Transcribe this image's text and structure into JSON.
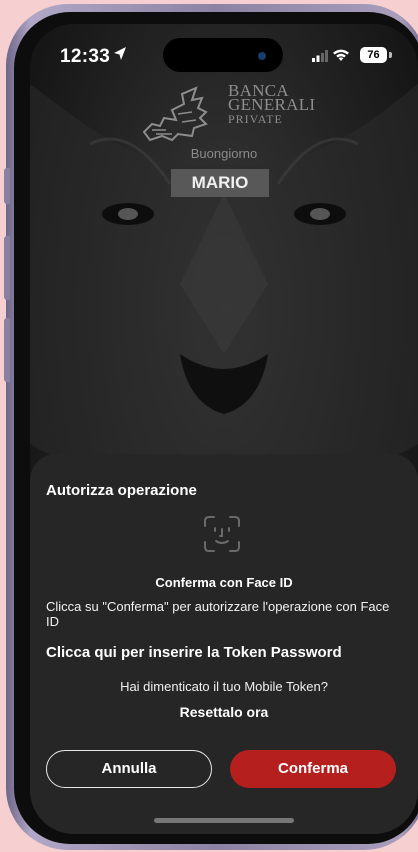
{
  "status_bar": {
    "time": "12:33",
    "battery": "76",
    "icons": [
      "location-arrow-icon",
      "signal-icon",
      "wifi-icon",
      "battery-icon"
    ]
  },
  "header": {
    "logo_lines": [
      "BANCA",
      "GENERALI",
      "PRIVATE"
    ],
    "greeting": "Buongiorno",
    "user_name": "MARIO"
  },
  "sheet": {
    "title": "Autorizza operazione",
    "faceid_title": "Conferma con Face ID",
    "faceid_description": "Clicca su \"Conferma\" per autorizzare l'operazione con Face ID",
    "token_link": "Clicca qui per inserire la Token Password",
    "forgot_text": "Hai dimenticato il tuo Mobile Token?",
    "reset_link": "Resettalo ora",
    "cancel_label": "Annulla",
    "confirm_label": "Conferma"
  },
  "colors": {
    "confirm_button": "#b5201f",
    "sheet_background": "#262626",
    "page_background": "#f6cfd0"
  }
}
